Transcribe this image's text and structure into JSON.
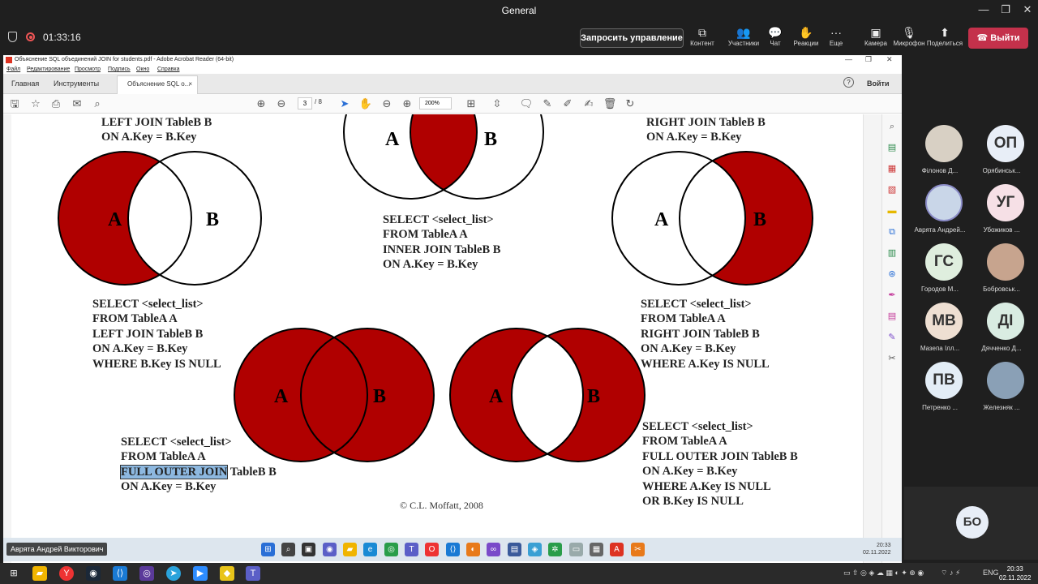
{
  "window": {
    "title": "General",
    "controls": [
      "—",
      "❐",
      "✕"
    ]
  },
  "call": {
    "timer": "01:33:16",
    "request_control_label": "Запросить управление",
    "buttons": [
      {
        "icon": "content-icon",
        "label": "Контент"
      },
      {
        "icon": "people-icon",
        "label": "Участники"
      },
      {
        "icon": "chat-icon",
        "label": "Чат"
      },
      {
        "icon": "reactions-icon",
        "label": "Реакции"
      },
      {
        "icon": "more-icon",
        "label": "Еще"
      },
      {
        "icon": "camera-off-icon",
        "label": "Камера"
      },
      {
        "icon": "mic-off-icon",
        "label": "Микрофон"
      },
      {
        "icon": "share-icon",
        "label": "Поделиться"
      }
    ],
    "leave_label": "Выйти",
    "leave_color": "#c4314b"
  },
  "acrobat": {
    "title": "Объяснение SQL объединений JOIN for students.pdf - Adobe Acrobat Reader (64-bit)",
    "menu": [
      "Файл",
      "Редактирование",
      "Просмотр",
      "Подпись",
      "Окно",
      "Справка"
    ],
    "tabs": {
      "home": "Главная",
      "tools": "Инструменты",
      "doc": "Объяснение SQL о...",
      "close": "×"
    },
    "help": "?",
    "login": "Войти",
    "page_current": "3",
    "page_total": "/ 8",
    "zoom": "200%"
  },
  "pdf": {
    "left_join_top": "LEFT JOIN TableB B\nON A.Key = B.Key",
    "right_join_top": "RIGHT JOIN TableB B\nON A.Key = B.Key",
    "inner_join": "SELECT <select_list>\nFROM TableA A\nINNER JOIN TableB B\nON A.Key = B.Key",
    "left_excl": "SELECT <select_list>\nFROM TableA A\nLEFT JOIN TableB B\nON A.Key = B.Key\nWHERE B.Key IS NULL",
    "right_excl": "SELECT <select_list>\nFROM TableA A\nRIGHT JOIN TableB B\nON A.Key = B.Key\nWHERE A.Key IS NULL",
    "full_outer": {
      "line1": "SELECT <select_list>",
      "line2": "FROM TableA A",
      "highlight": "FULL OUTER JOIN",
      "line3_rest": " TableB B",
      "line4": "ON A.Key = B.Key"
    },
    "full_excl": "SELECT <select_list>\nFROM TableA A\nFULL OUTER JOIN TableB B\nON A.Key = B.Key\nWHERE A.Key IS NULL\nOR B.Key IS NULL",
    "copyright": "© C.L. Moffatt, 2008",
    "label_a": "A",
    "label_b": "B",
    "fill_color": "#b00000"
  },
  "presenter": "Аврята Андрей Викторович",
  "inner_clock": {
    "time": "20:33",
    "date": "02.11.2022"
  },
  "participants": [
    {
      "name": "Філонов Д...",
      "initials": "",
      "bg": "#d8d0c4"
    },
    {
      "name": "Орябинськ...",
      "initials": "ОП",
      "bg": "#e8eef7"
    },
    {
      "name": "Аврята Андрей...",
      "initials": "",
      "bg": "#c9d6e8"
    },
    {
      "name": "Убожиков ...",
      "initials": "УГ",
      "bg": "#f6e0e6"
    },
    {
      "name": "Городов М...",
      "initials": "ГС",
      "bg": "#dfeede"
    },
    {
      "name": "Бобровськ...",
      "initials": "",
      "bg": "#c7a48e"
    },
    {
      "name": "Мазепа Ілл...",
      "initials": "МВ",
      "bg": "#eedfd2"
    },
    {
      "name": "Дячченко Д...",
      "initials": "ДІ",
      "bg": "#d9ece2"
    },
    {
      "name": "Петренко ...",
      "initials": "ПВ",
      "bg": "#e3edf6"
    },
    {
      "name": "Железняк ...",
      "initials": "",
      "bg": "#8aa0b6"
    }
  ],
  "me": {
    "initials": "БО"
  },
  "taskbar": {
    "lang": "ENG",
    "time": "20:33",
    "date": "02.11.2022"
  }
}
